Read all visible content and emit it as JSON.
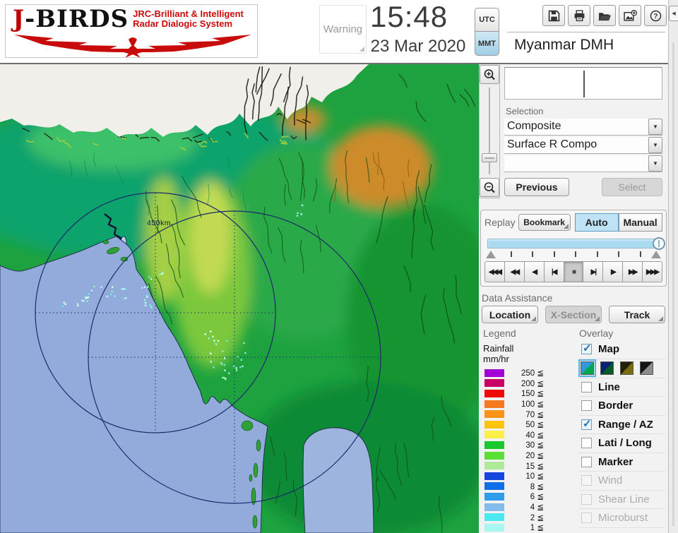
{
  "header": {
    "logo": {
      "title": "J-BIRDS",
      "sub1": "JRC-Brilliant & Intelligent",
      "sub2": "Radar  Dialogic  System"
    },
    "warning": "Warning",
    "time": "15:48",
    "date": "23 Mar 2020",
    "tz_utc": "UTC",
    "tz_mmt": "MMT",
    "tz_selected": "MMT",
    "agency": "Myanmar DMH"
  },
  "map": {
    "range_label": "450km"
  },
  "selection": {
    "label": "Selection",
    "dropdown1": "Composite",
    "dropdown2": "Surface R Compo",
    "dropdown3": "",
    "previous": "Previous",
    "select": "Select"
  },
  "replay": {
    "label": "Replay",
    "bookmark": "Bookmark",
    "auto": "Auto",
    "manual": "Manual",
    "mode_selected": "Auto",
    "playback": [
      "◀◀◀",
      "◀◀",
      "◀",
      "|◀",
      "■",
      "▶|",
      "▶",
      "▶▶",
      "▶▶▶"
    ]
  },
  "data_assistance": {
    "label": "Data Assistance",
    "location": "Location",
    "xsection": "X-Section",
    "track": "Track"
  },
  "legend": {
    "label": "Legend",
    "title1": "Rainfall",
    "title2": "mm/hr",
    "entries": [
      {
        "label": "250 ≦",
        "color": "#A100D4"
      },
      {
        "label": "200 ≦",
        "color": "#C90064"
      },
      {
        "label": "150 ≦",
        "color": "#EE0808"
      },
      {
        "label": "100 ≦",
        "color": "#F57A1E"
      },
      {
        "label": "70 ≦",
        "color": "#FB9318"
      },
      {
        "label": "50 ≦",
        "color": "#FDC40C"
      },
      {
        "label": "40 ≦",
        "color": "#FBEF4A"
      },
      {
        "label": "30 ≦",
        "color": "#17C92F"
      },
      {
        "label": "20 ≦",
        "color": "#59E032"
      },
      {
        "label": "15 ≦",
        "color": "#AEEA9A"
      },
      {
        "label": "10 ≦",
        "color": "#1545DC"
      },
      {
        "label": "8 ≦",
        "color": "#106FE8"
      },
      {
        "label": "6 ≦",
        "color": "#2F9BEB"
      },
      {
        "label": "4 ≦",
        "color": "#83BBEA"
      },
      {
        "label": "2 ≦",
        "color": "#4AE8EF"
      },
      {
        "label": "1 ≦",
        "color": "#A8F7F0"
      }
    ]
  },
  "overlay": {
    "label": "Overlay",
    "items": [
      {
        "label": "Map",
        "checked": true,
        "disabled": false
      },
      {
        "label": "Line",
        "checked": false,
        "disabled": false
      },
      {
        "label": "Border",
        "checked": false,
        "disabled": false
      },
      {
        "label": "Range / AZ",
        "checked": true,
        "disabled": false
      },
      {
        "label": "Lati / Long",
        "checked": false,
        "disabled": false
      },
      {
        "label": "Marker",
        "checked": false,
        "disabled": false
      },
      {
        "label": "Wind",
        "checked": false,
        "disabled": true
      },
      {
        "label": "Shear Line",
        "checked": false,
        "disabled": true
      },
      {
        "label": "Microburst",
        "checked": false,
        "disabled": true
      }
    ],
    "map_styles": [
      {
        "a": "#2E9BDE",
        "b": "#00A84E"
      },
      {
        "a": "#0A2070",
        "b": "#0B5A26"
      },
      {
        "a": "#23200A",
        "b": "#7A6C12"
      },
      {
        "a": "#141414",
        "b": "#8C8C8C"
      }
    ],
    "selected_style": 0
  }
}
